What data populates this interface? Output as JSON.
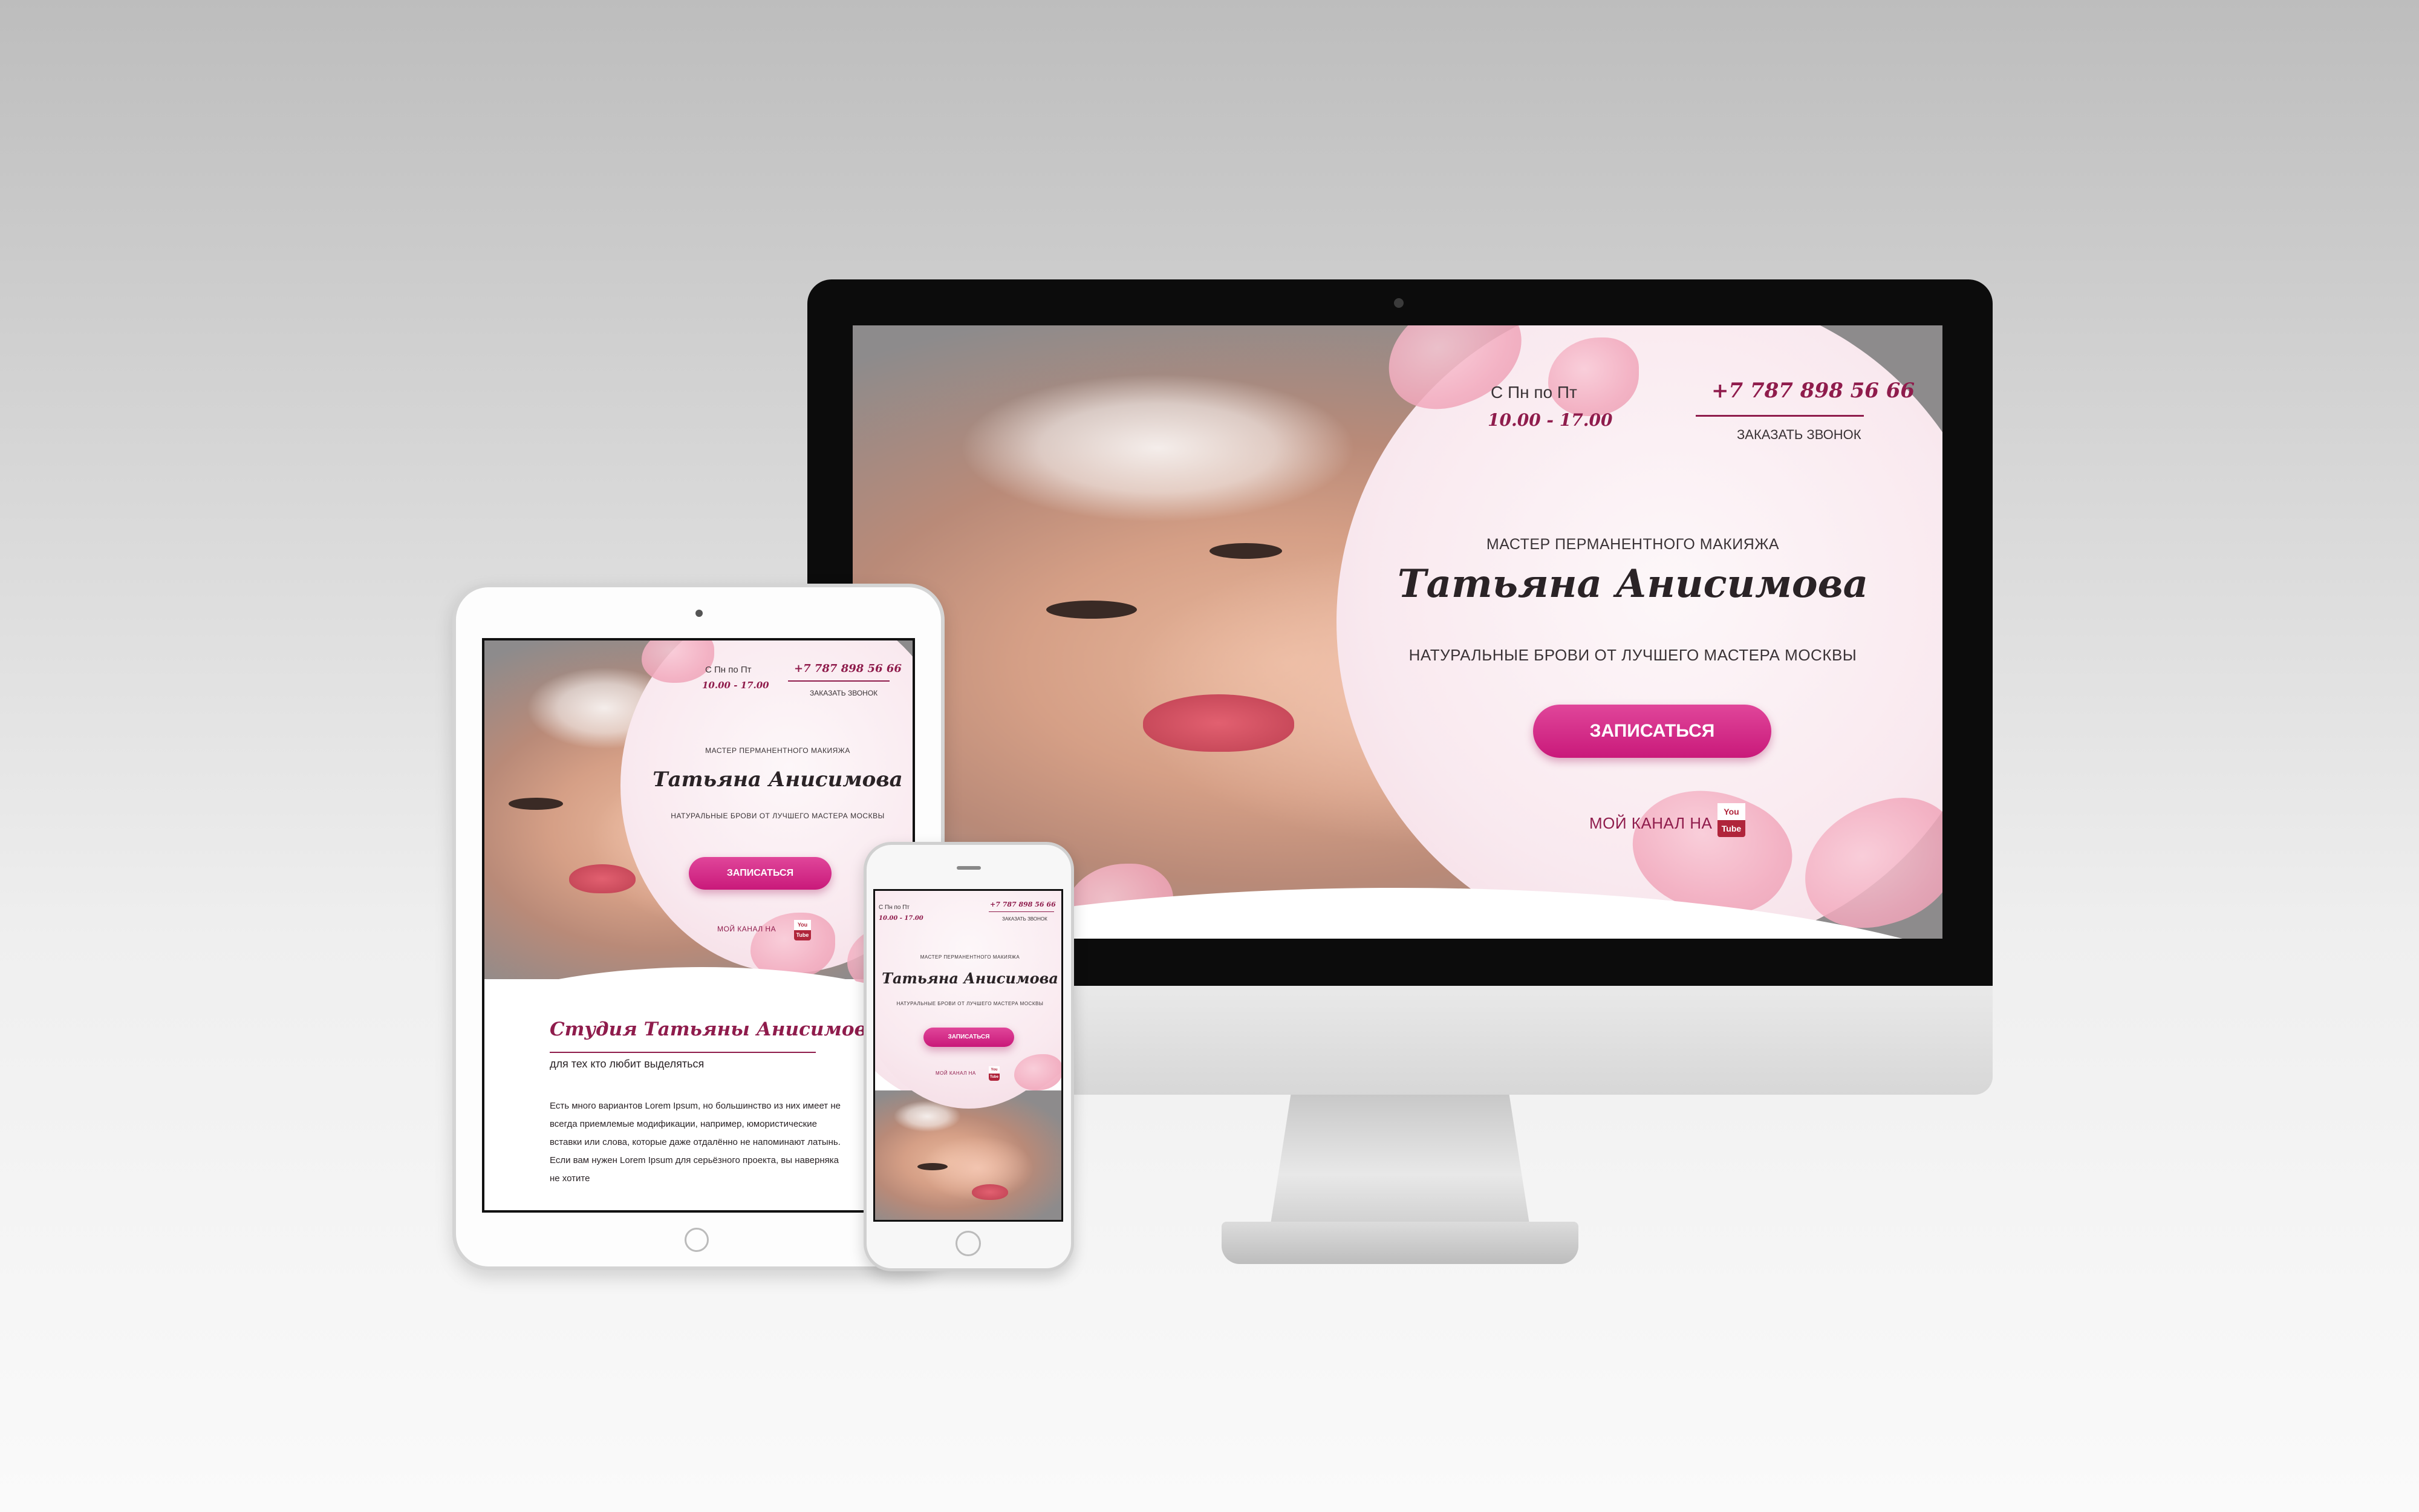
{
  "landing": {
    "hours_prefix": "С Пн по Пт",
    "hours": "10.00 - 17.00",
    "phone": "+7 787 898 56 66",
    "callback": "ЗАКАЗАТЬ ЗВОНОК",
    "role": "МАСТЕР ПЕРМАНЕНТНОГО МАКИЯЖА",
    "name": "Татьяна Анисимова",
    "tagline": "НАТУРАЛЬНЫЕ БРОВИ ОТ ЛУЧШЕГО МАСТЕРА МОСКВЫ",
    "cta": "ЗАПИСАТЬСЯ",
    "channel": "МОЙ КАНАЛ НА",
    "youtube_top": "You",
    "youtube_bottom": "Tube"
  },
  "studio": {
    "title": "Студия Татьяны Анисимовой",
    "subtitle": "для тех кто любит выделяться",
    "body": "Есть много вариантов Lorem Ipsum, но большинство из них имеет не всегда приемлемые модификации, например, юмористические вставки или слова, которые даже отдалённо не напоминают латынь. Если вам нужен Lorem Ipsum для серьёзного проекта, вы наверняка не хотите"
  },
  "colors": {
    "accent": "#c9197a",
    "brand_dark": "#8f1c4c",
    "petal": "#f2a9bd"
  }
}
